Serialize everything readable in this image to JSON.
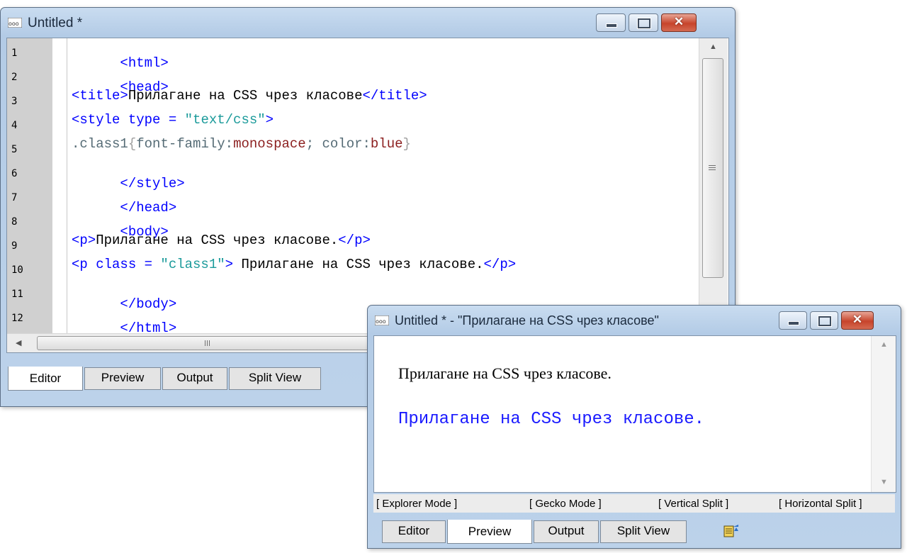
{
  "editor": {
    "title": "Untitled *",
    "line_numbers": [
      "1",
      "2",
      "3",
      "4",
      "5",
      "6",
      "7",
      "8",
      "9",
      "10",
      "11",
      "12"
    ],
    "code": [
      {
        "tag_open": "<html>"
      },
      {
        "tag_open": "<head>"
      },
      {
        "l3_open": "<title>",
        "l3_text": "Прилагане на CSS чрез класове",
        "l3_close": "</title>"
      },
      {
        "l4_a": "<style type = ",
        "l4_str": "\"text/css\"",
        "l4_b": ">"
      },
      {
        "l5_sel": ".class1",
        "l5_ob": "{",
        "l5_p1": "font-family:",
        "l5_v1": "monospace",
        "l5_semi": "; ",
        "l5_p2": "color:",
        "l5_v2": "blue",
        "l5_cb": "}"
      },
      {
        "tag_open": "</style>"
      },
      {
        "tag_open": "</head>"
      },
      {
        "tag_open": "<body>"
      },
      {
        "l9_open": "<p>",
        "l9_text": "Прилагане на CSS чрез класове.",
        "l9_close": "</p>"
      },
      {
        "l10_a": "<p class = ",
        "l10_str": "\"class1\"",
        "l10_b": ">",
        "l10_text": " Прилагане на CSS чрез класове.",
        "l10_close": "</p>"
      },
      {
        "tag_open": "</body>"
      },
      {
        "tag_open": "</html>"
      }
    ],
    "tabs": [
      "Editor",
      "Preview",
      "Output",
      "Split View"
    ]
  },
  "preview": {
    "title": "Untitled * - \"Прилагане на CSS чрез класове\"",
    "paragraph1": "Прилагане на CSS чрез класове.",
    "paragraph2": "Прилагане на CSS чрез класове.",
    "modes": [
      "[ Explorer Mode ]",
      "[ Gecko Mode ]",
      "[ Vertical Split ]",
      "[ Horizontal Split ]"
    ],
    "tabs": [
      "Editor",
      "Preview",
      "Output",
      "Split View"
    ]
  },
  "window_controls": {
    "minimize": "minimize",
    "maximize": "maximize",
    "close": "✕"
  },
  "colors": {
    "tag": "#0000ff",
    "string": "#1c9b9b",
    "css_value": "#8b1e1e",
    "class1_text": "#1a1aff"
  }
}
